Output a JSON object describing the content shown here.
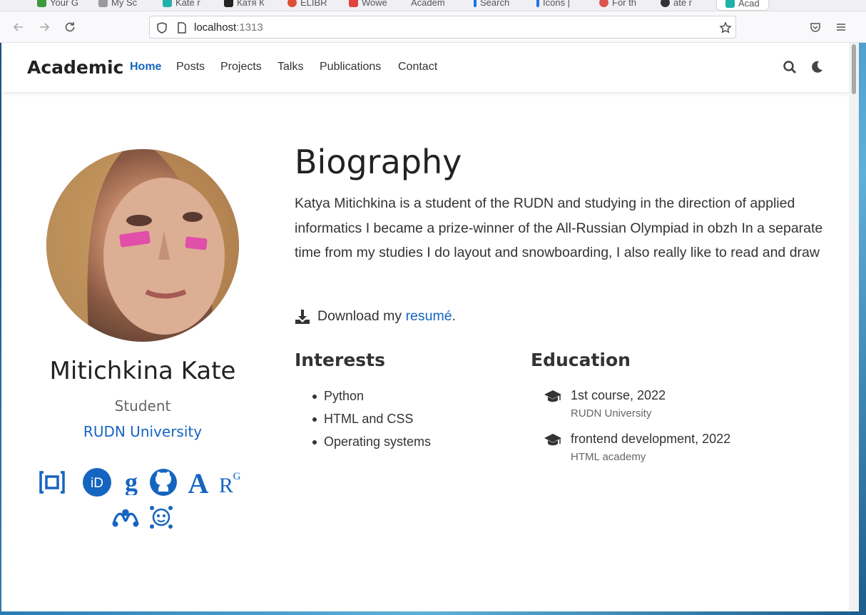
{
  "browser": {
    "tabs": [
      {
        "label": "Your G",
        "color": "#3c9a3c"
      },
      {
        "label": "My Sc",
        "color": "#888888"
      },
      {
        "label": "Kate r",
        "color": "#20b2aa"
      },
      {
        "label": "Катя К",
        "color": "#222222"
      },
      {
        "label": "ELIBR",
        "color": "#e04e39"
      },
      {
        "label": "Wowe",
        "color": "#e0443c"
      },
      {
        "label": "Academ",
        "color": "#ffffff"
      },
      {
        "label": "Search",
        "color": "#1a73e8"
      },
      {
        "label": "Icons |",
        "color": "#1a73e8"
      },
      {
        "label": "For th",
        "color": "#d9534f"
      },
      {
        "label": "ate r",
        "color": "#333333"
      },
      {
        "label": "Acad",
        "color": "#20b2aa"
      }
    ],
    "url_host": "localhost",
    "url_port": ":1313"
  },
  "site": {
    "brand": "Academic",
    "menu": [
      "Home",
      "Posts",
      "Projects",
      "Talks",
      "Publications",
      "Contact"
    ],
    "active_menu": "Home"
  },
  "profile": {
    "name": "Mitichkina Kate",
    "role": "Student",
    "organization": "RUDN University",
    "social": [
      "email-icon",
      "orcid-icon",
      "google-scholar-icon",
      "github-icon",
      "academia-icon",
      "researchgate-icon",
      "mendeley-icon",
      "kaggle-icon"
    ]
  },
  "bio": {
    "title": "Biography",
    "text": "Katya Mitichkina is a student of the RUDN and studying in the direction of applied informatics I became a prize-winner of the All-Russian Olympiad in obzh In a separate time from my studies I do layout and snowboarding, I also really like to read and draw",
    "download_prefix": "Download my ",
    "download_link": "resumé",
    "download_suffix": "."
  },
  "interests": {
    "title": "Interests",
    "items": [
      "Python",
      "HTML and CSS",
      "Operating systems"
    ]
  },
  "education": {
    "title": "Education",
    "items": [
      {
        "course": "1st course, 2022",
        "institution": "RUDN University"
      },
      {
        "course": "frontend development, 2022",
        "institution": "HTML academy"
      }
    ]
  },
  "colors": {
    "accent": "#1565c0",
    "text": "#333333"
  }
}
